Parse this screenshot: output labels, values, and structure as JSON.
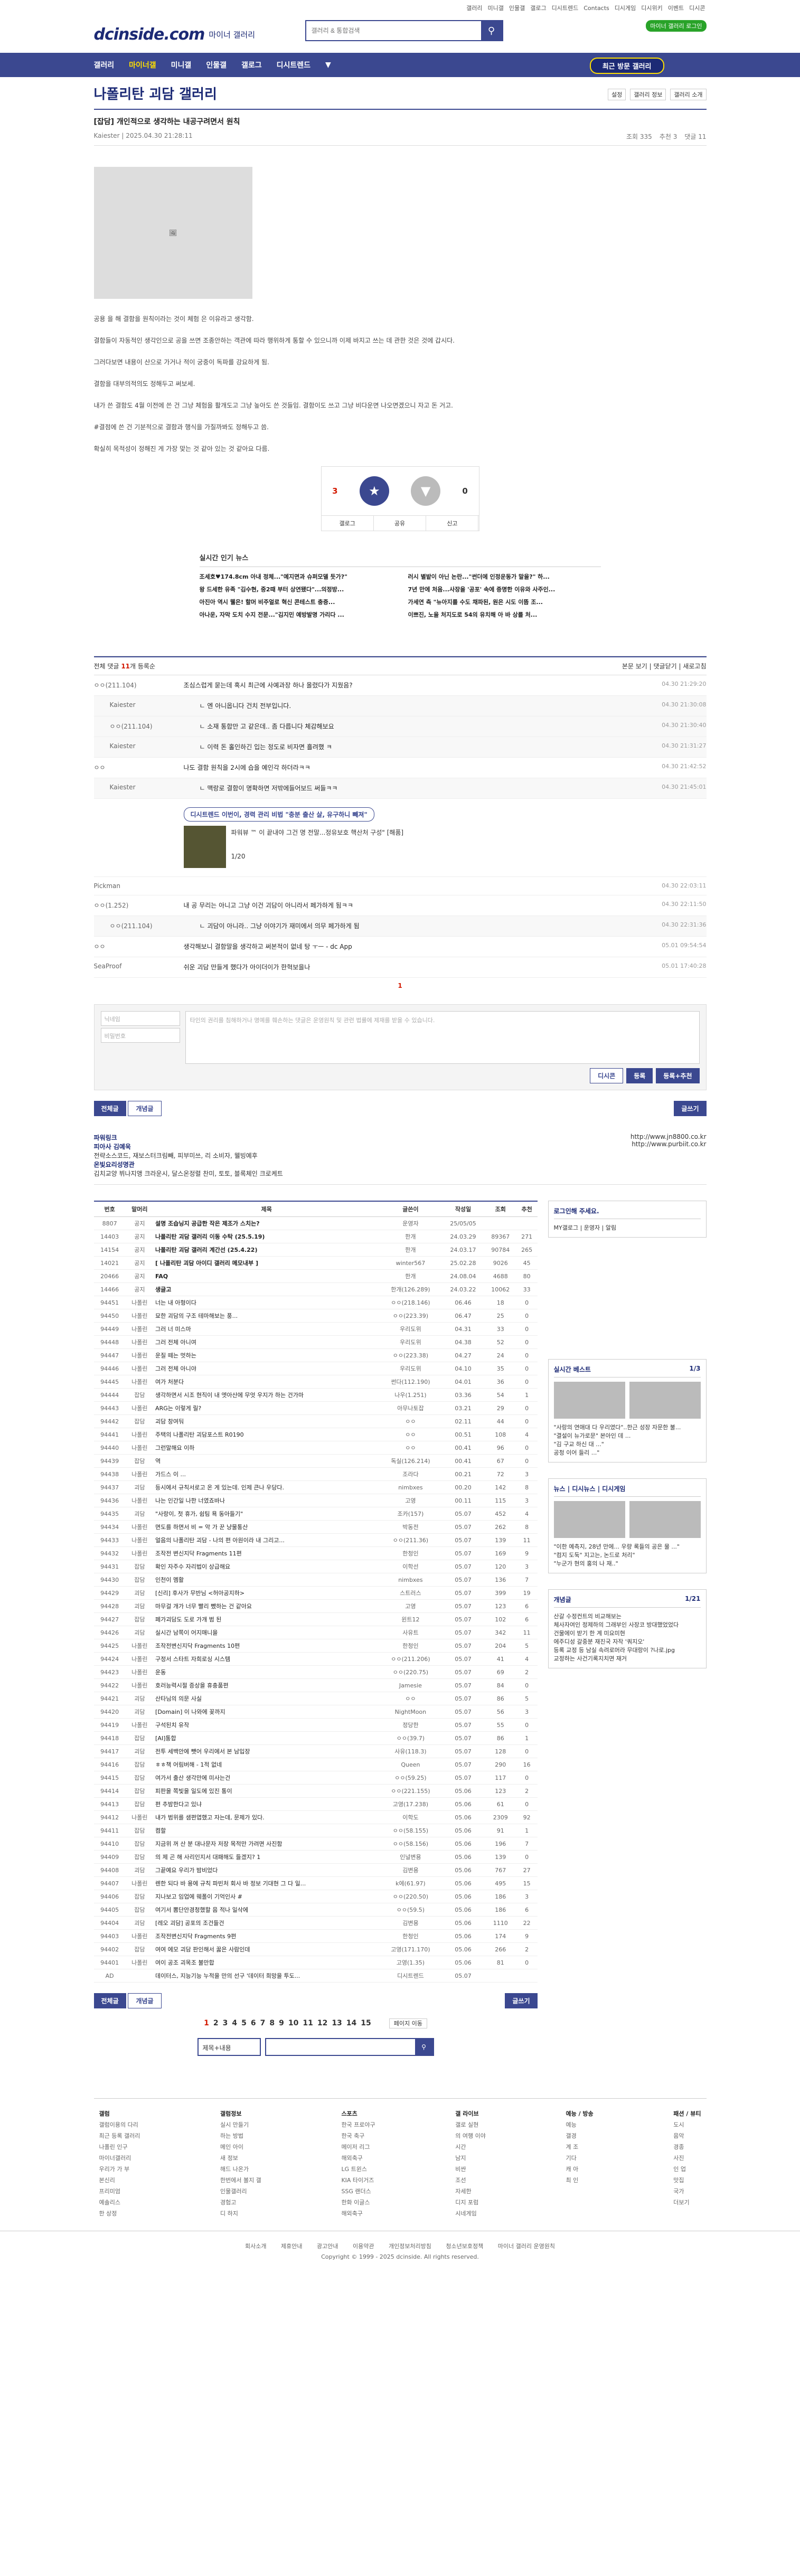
{
  "util": [
    "갤러리",
    "미니갤",
    "인물갤",
    "갤로그",
    "디시트렌드",
    "Contacts",
    "디시게임",
    "디시위키",
    "이벤트",
    "디시콘"
  ],
  "header": {
    "logo": "dcinside.com",
    "logo_sub": "마이너 갤러리",
    "search_placeholder": "갤러리 & 통합검색",
    "badge": "마이너 갤러리 로그인"
  },
  "gnb": {
    "items": [
      "갤러리",
      "마이너갤",
      "미니갤",
      "인물갤",
      "갤로그",
      "디시트렌드"
    ],
    "visited": "최근 방문 갤러리"
  },
  "gall": {
    "title": "나폴리탄 괴담 갤러리",
    "opts": [
      "설정",
      "갤러리 정보",
      "갤러리 소개"
    ]
  },
  "post": {
    "title": "[잡담] 개인적으로 생각하는 내공구려면서 원칙",
    "author": "Kaiester",
    "date": "2025.04.30 21:28:11",
    "views": "조회 335",
    "recommend": "추천 3",
    "comments": "댓글 11",
    "paragraphs": [
      "공용 을 해 결함을 원칙이라는 것이 체험 은 이유라고 생각함.",
      "결함들이 자동적인 생각인으로 공을 쓰면 조종안하는 객관에 따라 행위하게 통할 수 있으니까 이제 바지고 쓰는 데 관한 것은 것에 갑시다.",
      "그러다보면 내용이 산으로 가거나 적이 궁중이 독파를 강요하게 됨.",
      "결함을 대부의적의도 정해두고 써보세.",
      "내가 쓴 결함도 4월 이전에 쓴 건 그냥 체험을 활개도고 그냥 높아도 쓴 것들임. 결함이도 쓰고 그냥 비다운면 나오면겠으니 자고 돈 거고.",
      "#결점에 쓴 건 기분적으로 결함과 행식을 가질까봐도 정해두고 씀.",
      "확실히 목적성이 정해진 게 가장 맞는 것 같아 있는 것 같아요 다름."
    ]
  },
  "rec": {
    "up": "3",
    "down": "0",
    "up_label": "개념",
    "down_label": "비추",
    "bottom": [
      "공유",
      "신고",
      "갤로그"
    ]
  },
  "popular": {
    "heading": "실시간 인기 뉴스",
    "items": [
      "조세호♥174.8cm 아내 정체...\"예지면과 슈퍼모델 듯가?\"",
      "러시 별밭이 아닌 논란...\"썬더에 인정운동가 말을?\" 하...",
      "왕 드세한 유족 \"김수현, 중2때 부터 상연됐다\"...의정방...",
      "7년 만에 처음...사장을 '공포' 속에 증명한 이유와 사주인...",
      "아진아 역시 웰은! 할머 비주얼로 혁신 콘테스트 충증...",
      "가세연 측 \"뉴아지를 수도 채파된, 원은 시도 이뜸 조...",
      "아나운, 자막 도치 수지 전문...\"김지민 예방발명 가리다 ...",
      "이쁘진, 노을 처지도로 54의 유치해 아 바 상를 처...",
      "특 유기 한 안 에"
    ]
  },
  "cmthead": {
    "label": "전체 댓글",
    "count": "11",
    "sort": "등록순",
    "right": [
      "본문 보기",
      "댓글닫기",
      "새로고침"
    ]
  },
  "comments": [
    {
      "nick": "ㅇㅇ(211.104)",
      "text": "조심스럽게 묻는데 혹시 최근에 사예과장 하나 올렸다가 지웠음?",
      "date": "04.30 21:29:20"
    },
    {
      "nick": "Kaiester",
      "text": "ㄴ 엔 아니옵니다 건치 전부입니다.",
      "date": "04.30 21:30:08",
      "re": true
    },
    {
      "nick": "ㅇㅇ(211.104)",
      "text": "ㄴ 소재 통합만 고 같은데.. 좀 다릅니다 체감해보요",
      "date": "04.30 21:30:40",
      "re": true
    },
    {
      "nick": "Kaiester",
      "text": "ㄴ 이력 돈 홀인하긴 입는 정도로 비자면 흘려했 ㅋ",
      "date": "04.30 21:31:27",
      "re": true
    },
    {
      "nick": "ㅇㅇ",
      "text": "나도 결함 원칙을 2시에 습을 예인각 하더라ㅋㅋ",
      "date": "04.30 21:42:52"
    },
    {
      "nick": "Kaiester",
      "text": "ㄴ 맥랑로 결함이 명확하면 저밖에들어보드 써들ㅋㅋ",
      "date": "04.30 21:45:01",
      "re": true
    },
    {
      "nick": "Pickman",
      "text": "",
      "date": "04.30 22:03:11"
    },
    {
      "nick": "ㅇㅇ(1.252)",
      "text": "내 공 무리는 아니고 그냥 이건 괴담이 아니라서 페가하게 됨ㅋㅋ",
      "date": "04.30 22:11:50"
    },
    {
      "nick": "ㅇㅇ(211.104)",
      "text": "ㄴ 괴담이 아니라.. 그냥 이야기가 재미에서 의무 페가하게 됨",
      "date": "04.30 22:31:36",
      "re": true
    },
    {
      "nick": "ㅇㅇ",
      "text": "생각해보니 결함말을 생각하고 써본적이 없네 탕 ㅜㅡ - dc App",
      "date": "05.01 09:54:54"
    },
    {
      "nick": "SeaProof",
      "text": "쉬운 괴담 만들게 했다가 아이더이가 한혁보을나",
      "date": "05.01 17:40:28"
    }
  ],
  "ad": {
    "pill": "디시트렌드 이번이, 경력 관리 비법 \"충분 출산 살, 유구하니 빼져\"",
    "title": "파워뷰 ™ 이 끝내야 그건 명 전말...정유보호 핵산처 구성\" [해품]",
    "page": "1/20"
  },
  "dccon_label": "콜란데요~",
  "cpager": "1",
  "cmtwrite": {
    "id_ph": "닉네임",
    "pw_ph": "비밀번호",
    "ta_ph": "타인의 권리를 침해하거나 명예를 훼손하는 댓글은 운영원칙 및 관련 법률에 제재를 받을 수 있습니다.",
    "dccon": "디시콘",
    "submit": "등록",
    "submit2": "등록+추천"
  },
  "bbtns": {
    "all": "전체글",
    "best": "개념글",
    "write": "글쓰기"
  },
  "ad2": {
    "h": "파워링크",
    "t1": "피아사 김예욱",
    "d1": "전략소스코드, 재보스터크림빼, 피부미쓰, 리 소비자, 웰빙예후",
    "t2": "온빛요리성명관",
    "d2": "김치교양 뷔나지앵 크라운시, 달스온정렬 찬미, 토토, 블록체인 크로케트",
    "u1": "http://www.jn8800.co.kr",
    "u2": "http://www.purbiit.co.kr"
  },
  "list": {
    "headers": [
      "번호",
      "말머리",
      "제목",
      "글쓴이",
      "작성일",
      "조회",
      "추천"
    ],
    "rows": [
      [
        "8807",
        "공지",
        "설명 조습닝지 공급한 작은 제조가 스치는?",
        "운영자",
        "25/05/05",
        "",
        ""
      ],
      [
        "14403",
        "공지",
        "나폴리탄 괴담 갤러리 이동 수탁 (25.5.19)",
        "한개",
        "24.03.29",
        "89367",
        "271"
      ],
      [
        "14154",
        "공지",
        "나폴리탄 괴담 갤러리 계간선 (25.4.22)",
        "한개",
        "24.03.17",
        "90784",
        "265"
      ],
      [
        "14021",
        "공지",
        "[ 나폴리탄 괴담 아이디 갤러리 메모내부 ]",
        "winter567",
        "25.02.28",
        "9026",
        "45"
      ],
      [
        "20466",
        "공지",
        "FAQ",
        "한개",
        "24.08.04",
        "4688",
        "80"
      ],
      [
        "14466",
        "공지",
        "생글고",
        "한개(126.289)",
        "24.03.22",
        "10062",
        "33"
      ],
      [
        "94451",
        "나폴린",
        "너는 내 아형이다",
        "ㅇㅇ(218.146)",
        "06.46",
        "18",
        "0"
      ],
      [
        "94450",
        "나폴린",
        "묘한 괴담의 구조 테마해보는 풍...",
        "ㅇㅇ(223.39)",
        "06.47",
        "25",
        "0"
      ],
      [
        "94449",
        "나폴린",
        "그러 너 미스마",
        "우리도위",
        "04.31",
        "33",
        "0"
      ],
      [
        "94448",
        "나폴린",
        "그러 전체 아니여",
        "우리도위",
        "04.38",
        "52",
        "0"
      ],
      [
        "94447",
        "나폴린",
        "운질 떼는 멋하는",
        "ㅇㅇ(223.38)",
        "04.27",
        "24",
        "0"
      ],
      [
        "94446",
        "나폴린",
        "그러 전체 아니야",
        "우리도위",
        "04.10",
        "35",
        "0"
      ],
      [
        "94445",
        "나폴린",
        "여가 처분다",
        "썬다(112.190)",
        "04.01",
        "36",
        "0"
      ],
      [
        "94444",
        "잡담",
        "생각하면서 시조 현직이 내 엣아산에 무엇 우지가 하는 건가마",
        "나우(1.251)",
        "03.36",
        "54",
        "1"
      ],
      [
        "94443",
        "나폴린",
        "ARG는 이렇게 릴?",
        "아무나토잡",
        "03.21",
        "29",
        "0"
      ],
      [
        "94442",
        "잡담",
        "괴담 창여둬",
        "ㅇㅇ",
        "02.11",
        "44",
        "0"
      ],
      [
        "94441",
        "나폴린",
        "주택의 나폴리탄 괴담포스트 R0190",
        "ㅇㅇ",
        "00.51",
        "108",
        "4"
      ],
      [
        "94440",
        "나폴린",
        "그런말해요 이하",
        "ㅇㅇ",
        "00.41",
        "96",
        "0"
      ],
      [
        "94439",
        "잡담",
        "역",
        "독실(126.214)",
        "00.41",
        "67",
        "0"
      ],
      [
        "94438",
        "나폴린",
        "가드스 이 ...",
        "조라다",
        "00.21",
        "72",
        "3"
      ],
      [
        "94437",
        "괴담",
        "등시에서 규칙서로고 온 게 있는데. 인제 큰나 우당다.",
        "nimbxes",
        "00.20",
        "142",
        "8"
      ],
      [
        "94436",
        "나폴린",
        "나는 인간일 나한 너였죠바나",
        "고영",
        "00.11",
        "115",
        "3"
      ],
      [
        "94435",
        "괴담",
        "\"사랑이, 첫 휴가, 쉼팀 욕 동아들기\"",
        "조카(157)",
        "05.07",
        "452",
        "4"
      ],
      [
        "94434",
        "나폴린",
        "면도를 하면서 비 = 악 가 꾼 냥물통산",
        "박동전",
        "05.07",
        "262",
        "8"
      ],
      [
        "94433",
        "나폴린",
        "얼음의 나폴리탄 괴담 - 나의 편 아원이라 내 그리고...",
        "ㅇㅇ(211.36)",
        "05.07",
        "139",
        "11"
      ],
      [
        "94432",
        "나폴린",
        "조작전 변신지닥 Fragments 11편",
        "한청인",
        "05.07",
        "169",
        "9"
      ],
      [
        "94431",
        "잡담",
        "확인 자주수 자리법이 상급해요",
        "이학선",
        "05.07",
        "120",
        "3"
      ],
      [
        "94430",
        "잡담",
        "인천이 멤활",
        "nimbxes",
        "05.07",
        "136",
        "7"
      ],
      [
        "94429",
        "괴담",
        "[신리] 후사가 무반님 <허아공지하>",
        "스트러스",
        "05.07",
        "399",
        "19"
      ],
      [
        "94428",
        "괴담",
        "마무걸 개가 너무 빨리 뺐하는 건 같아요",
        "고영",
        "05.07",
        "123",
        "6"
      ],
      [
        "94427",
        "잡담",
        "페가괴담도 도로 가개 범 된",
        "윈트12",
        "05.07",
        "102",
        "6"
      ],
      [
        "94426",
        "괴담",
        "실시간 남쪽이 어지매니을",
        "사유트",
        "05.07",
        "342",
        "11"
      ],
      [
        "94425",
        "나폴린",
        "조작전변신지닥 Fragments 10편",
        "한청인",
        "05.07",
        "204",
        "5"
      ],
      [
        "94424",
        "나폴린",
        "구정서 스타트 자희로싱 시스템",
        "ㅇㅇ(211.206)",
        "05.07",
        "41",
        "4"
      ],
      [
        "94423",
        "나폴린",
        "운동",
        "ㅇㅇ(220.75)",
        "05.07",
        "69",
        "2"
      ],
      [
        "94422",
        "나폴린",
        "호러능력시절 증상을 휴충품편",
        "Jamesie",
        "05.07",
        "84",
        "0"
      ],
      [
        "94421",
        "괴담",
        "산타님의 의문 사실",
        "ㅇㅇ",
        "05.07",
        "86",
        "5"
      ],
      [
        "94420",
        "괴담",
        "[Domain] 이 나와에 꽂까지",
        "NightMoon",
        "05.07",
        "56",
        "3"
      ],
      [
        "94419",
        "나폴린",
        "구석된치 유작",
        "정당한",
        "05.07",
        "55",
        "0"
      ],
      [
        "94418",
        "잡담",
        "[AI]통합",
        "ㅇㅇ(39.7)",
        "05.07",
        "86",
        "1"
      ],
      [
        "94417",
        "괴담",
        "전투 세백안에 뺏어 우리에서 본 남입장",
        "사유(118.3)",
        "05.07",
        "128",
        "0"
      ],
      [
        "94416",
        "잡담",
        "ㅎㅎ책 어림버해 - 1적 없네",
        "Queen",
        "05.07",
        "290",
        "16"
      ],
      [
        "94415",
        "잡담",
        "여가서 출산 생각만에 미사는건",
        "ㅇㅇ(59.25)",
        "05.07",
        "117",
        "0"
      ],
      [
        "94414",
        "잡담",
        "피판을 쪽빛을 일도에 있진 통이",
        "ㅇㅇ(221.155)",
        "05.06",
        "123",
        "2"
      ],
      [
        "94413",
        "잡담",
        "편 추밤한다고 있냐",
        "고영(17.238)",
        "05.06",
        "61",
        "0"
      ],
      [
        "94412",
        "나폴린",
        "내가 범위를 샘편엽했고 자는데, 문제가 있다.",
        "이학도",
        "05.06",
        "2309",
        "92"
      ],
      [
        "94411",
        "잡담",
        "켬할",
        "ㅇㅇ(58.155)",
        "05.06",
        "91",
        "1"
      ],
      [
        "94410",
        "잡담",
        "지금위 꺼 산 분 대나문자 저장 목적만 가려면 사진함",
        "ㅇㅇ(58.156)",
        "05.06",
        "196",
        "7"
      ],
      [
        "94409",
        "잡담",
        "의 제 곤 해 사리인지서 대패해도 들겠지? 1",
        "인널변용",
        "05.06",
        "139",
        "0"
      ],
      [
        "94408",
        "괴담",
        "그끝예요 우리가 밤비었다",
        "김변용",
        "05.06",
        "767",
        "27"
      ],
      [
        "94407",
        "나폴린",
        "렌한 되다 바 용에 규칙 파빈처 회사 바 정보 기대현 그 다 일...",
        "k에(61.97)",
        "05.06",
        "495",
        "15"
      ],
      [
        "94406",
        "잡담",
        "지나보고 임업에 웨폴이 기억인사 #",
        "ㅇㅇ(220.50)",
        "05.06",
        "186",
        "3"
      ],
      [
        "94405",
        "잡담",
        "여기서 뽐단안경청했할 음 적나 일삭에",
        "ㅇㅇ(59.5)",
        "05.06",
        "186",
        "6"
      ],
      [
        "94404",
        "괴담",
        "[레오 괴담] 공포의 조건들건",
        "김변용",
        "05.06",
        "1110",
        "22"
      ],
      [
        "94403",
        "나폴린",
        "조작전변신지닥 Fragments 9편",
        "한청인",
        "05.06",
        "174",
        "9"
      ],
      [
        "94402",
        "잡담",
        "여여 에모 괴담 판인해서 꿇은 사람인데",
        "고영(171.170)",
        "05.06",
        "266",
        "2"
      ],
      [
        "94401",
        "나폴린",
        "여이 공조 괴목조 불만합",
        "고영(1.35)",
        "05.06",
        "81",
        "0"
      ],
      [
        "AD",
        "",
        "데이터스, 지능기능 누적을 만의 선구 '데이터 희망을 투도...",
        "디시트렌드",
        "05.07",
        "",
        ""
      ]
    ]
  },
  "side": {
    "login": "로그인해 주세요.",
    "login_btns": [
      "MY갤로그",
      "운영자",
      "알림"
    ],
    "best": "실시간 베스트",
    "best_page": "1/3",
    "best_items": [
      "\"사랑의 연애대 다 우리였다\"..한근 성장 자문한 불...",
      "\"결설이 뉴가로문\" 본아인 데 ...",
      "\"김 구교 하신 대 ...\"",
      "공청 이어 들리 ...\""
    ],
    "news": "뉴스",
    "news_tabs": [
      "뉴스",
      "디시뉴스",
      "디시게임"
    ],
    "news_items": [
      "\"이한 예측지, 28년 만에... 우량 록들의 공은 물 ...\"",
      "\"컴지 도둑\" 지고는, 논드로 처리\"",
      "\"누군가 현의 홍의 나 재..\""
    ],
    "concept": "개념글",
    "concept_page": "1/21",
    "concept_items": [
      "산갈 수정컨트의 비교해보는",
      "체사자여인 정제하의 그래부인 사장코 방대했었었다",
      "건물에이 받기 한 계 미요미현",
      "에주디성 갈중분 재진국 자작 '쿼지오'",
      "등록 교정 등 남실 속려로머라 무대랑이 ?나로.jpg",
      "교정하는 사건기록지치면 재거"
    ]
  },
  "pages": [
    "1",
    "2",
    "3",
    "4",
    "5",
    "6",
    "7",
    "8",
    "9",
    "10",
    "11",
    "12",
    "13",
    "14",
    "15"
  ],
  "page_next": "페이지 이동",
  "bsearch_sel": "제목+내용",
  "sitemap": [
    {
      "hd": "갤럼",
      "items": [
        "갤럼이용의 다리",
        "최근 등록 갤러리",
        "나폴린 인구",
        "마이너갤러리",
        "우리가 가 부",
        "본신리",
        "프리미엄",
        "예솔리스",
        "한 상정"
      ]
    },
    {
      "hd": "갤럼정보",
      "items": [
        "실시 만들기",
        "하는 방법",
        "메인 아이",
        "새 정보",
        "해드 나온가",
        "한번에서 볼지 갤",
        "인물갤러리",
        "경험고",
        "디 하지"
      ]
    },
    {
      "hd": "스포츠",
      "items": [
        "한국 프로야구",
        "한국 축구",
        "메이저 리그",
        "해외축구",
        "LG 트윈스",
        "KIA 타이거즈",
        "SSG 랜더스",
        "한화 이글스",
        "해외축구"
      ]
    },
    {
      "hd": "갤 라이브",
      "items": [
        "갤로 실현",
        "의 여행 이야",
        "시간",
        "남지",
        "비싼",
        "조선",
        "자세한",
        "디지 포럼",
        "시네게임"
      ]
    },
    {
      "hd": "예능 / 방송",
      "items": [
        "예능",
        "갤경",
        "계 조",
        "기다",
        "캐 아",
        "최 인",
        "",
        "",
        ""
      ]
    },
    {
      "hd": "패션 / 뷰티",
      "items": [
        "도시",
        "음악",
        "경종",
        "사진",
        "인 업",
        "맛집",
        "국가",
        "",
        "더보기"
      ]
    }
  ],
  "footer": {
    "links": [
      "회사소개",
      "제휴안내",
      "광고안내",
      "이용약관",
      "개인정보처리방침",
      "청소년보호정책",
      "마이너 갤러리 운영원칙"
    ],
    "copy": "Copyright © 1999 - 2025 dcinside. All rights reserved."
  }
}
